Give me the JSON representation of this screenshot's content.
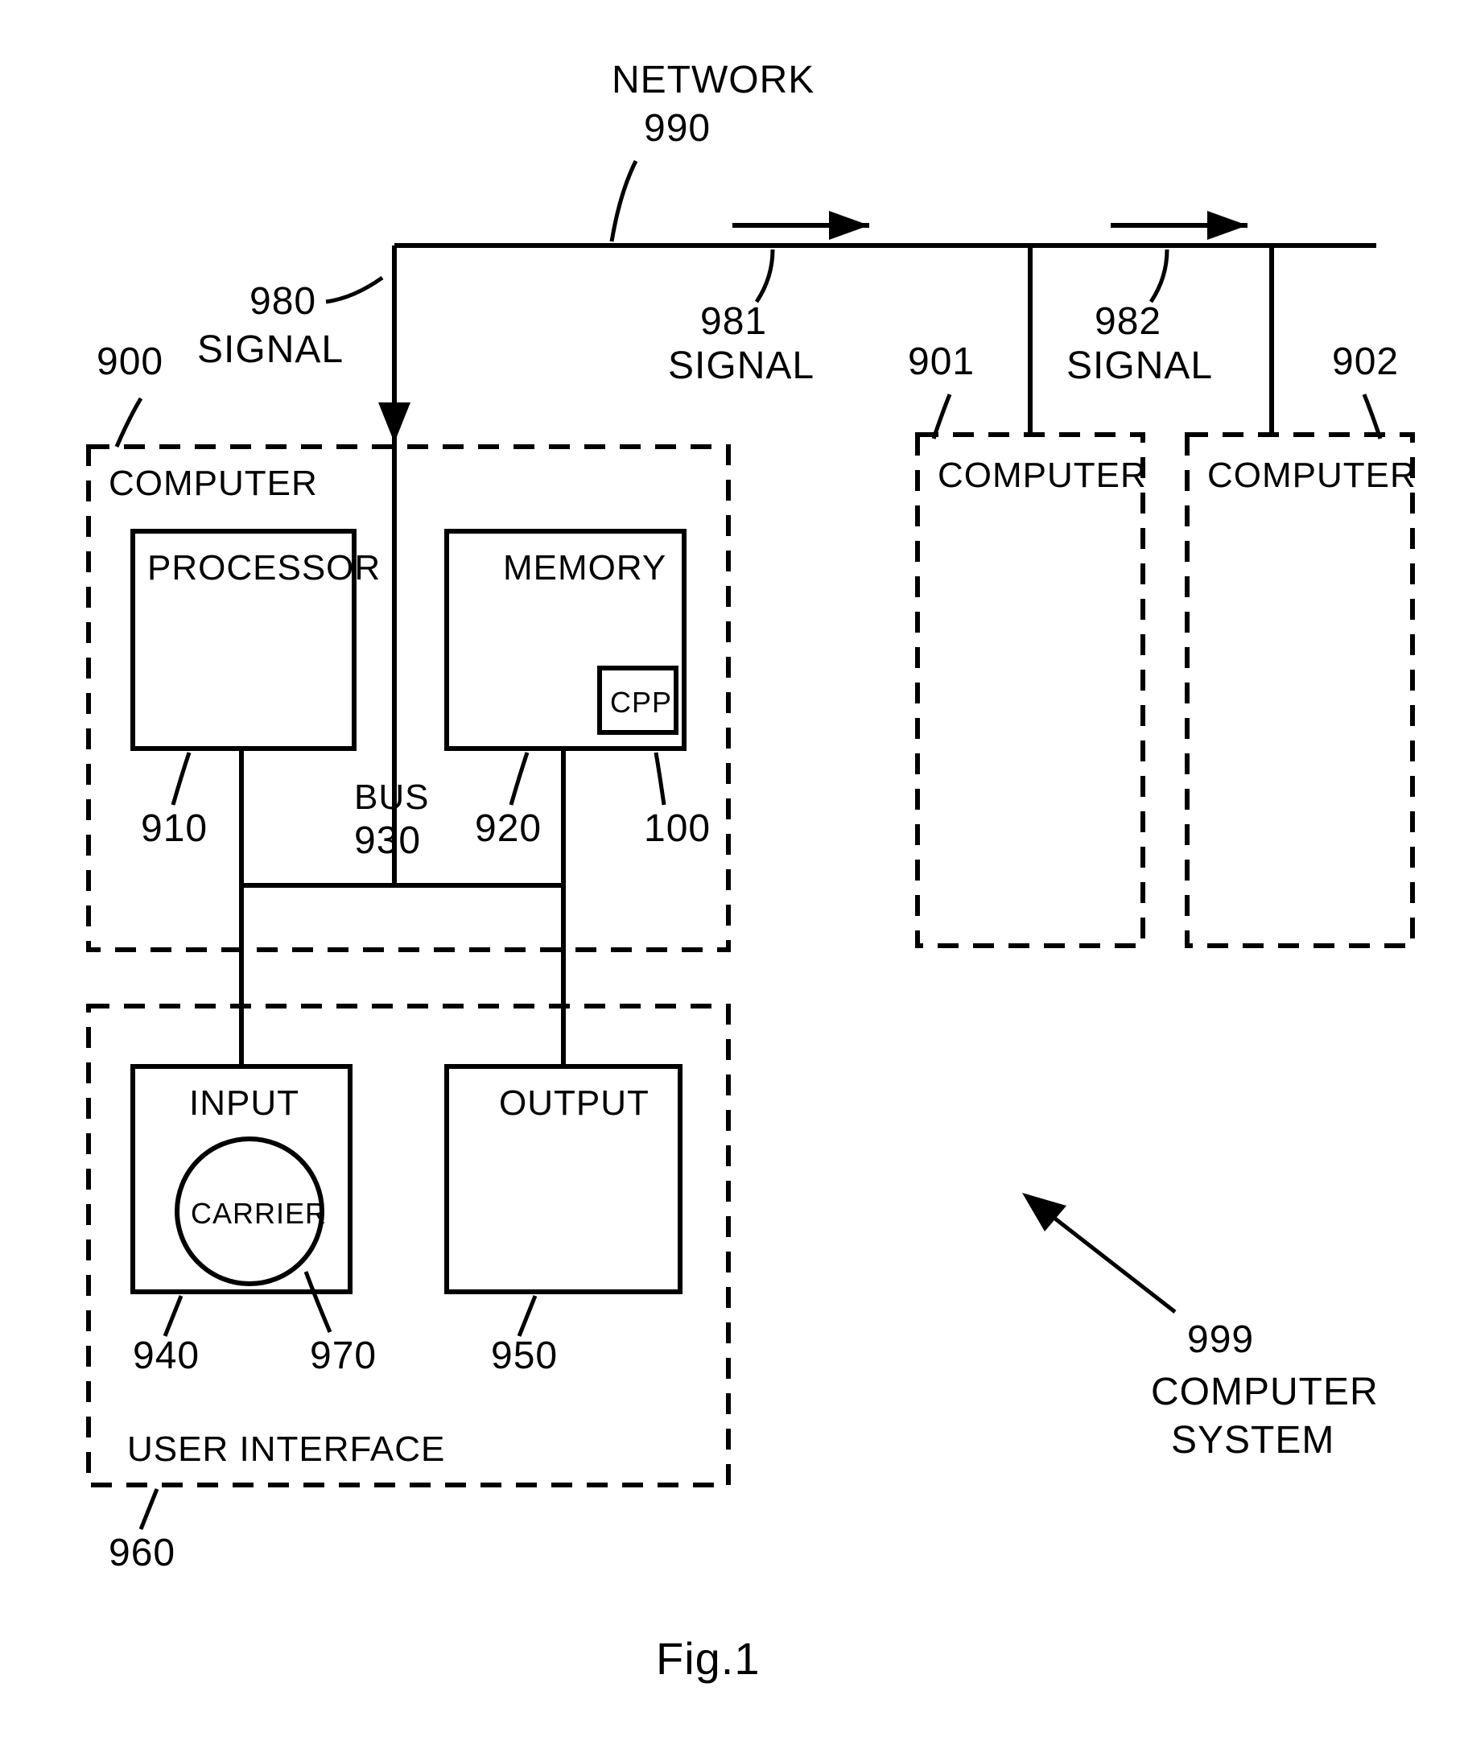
{
  "figure_caption": "Fig.1",
  "network": {
    "label": "NETWORK",
    "ref": "990"
  },
  "signals": {
    "s980": {
      "ref": "980",
      "label": "SIGNAL"
    },
    "s981": {
      "ref": "981",
      "label": "SIGNAL"
    },
    "s982": {
      "ref": "982",
      "label": "SIGNAL"
    }
  },
  "computers": {
    "c900": {
      "ref": "900",
      "label": "COMPUTER"
    },
    "c901": {
      "ref": "901",
      "label": "COMPUTER"
    },
    "c902": {
      "ref": "902",
      "label": "COMPUTER"
    }
  },
  "computer900": {
    "processor": {
      "label": "PROCESSOR",
      "ref": "910"
    },
    "memory": {
      "label": "MEMORY",
      "ref": "920"
    },
    "cpp": {
      "label": "CPP",
      "ref": "100"
    },
    "bus": {
      "label": "BUS",
      "ref": "930"
    }
  },
  "ui": {
    "label": "USER INTERFACE",
    "ref": "960",
    "input": {
      "label": "INPUT",
      "ref": "940"
    },
    "output": {
      "label": "OUTPUT",
      "ref": "950"
    },
    "carrier": {
      "label": "CARRIER",
      "ref": "970"
    }
  },
  "system": {
    "ref": "999",
    "label1": "COMPUTER",
    "label2": "SYSTEM"
  }
}
